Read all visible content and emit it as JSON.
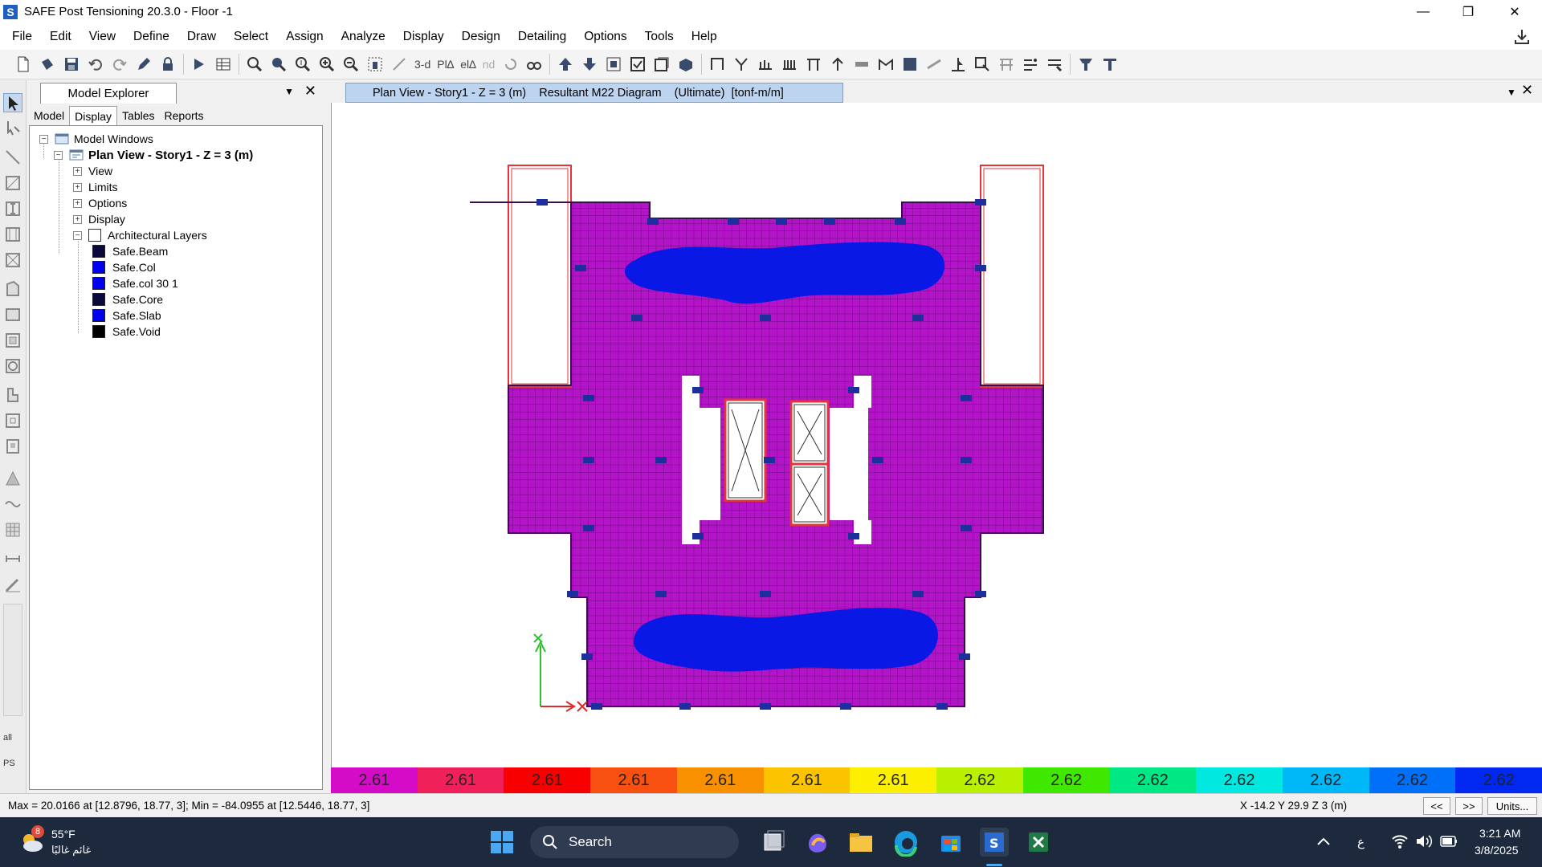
{
  "window": {
    "title": "SAFE Post Tensioning 20.3.0 - Floor -1",
    "app_icon_letter": "S",
    "minimize": "—",
    "maximize": "❐",
    "close": "✕"
  },
  "menu": [
    "File",
    "Edit",
    "View",
    "Define",
    "Draw",
    "Select",
    "Assign",
    "Analyze",
    "Display",
    "Design",
    "Detailing",
    "Options",
    "Tools",
    "Help"
  ],
  "toolbar": {
    "text_3d": "3-d",
    "text_pla": "Pl∆",
    "text_ela": "el∆",
    "text_nd": "nd"
  },
  "left_strip": {
    "all_label": "all",
    "ps_label": "PS"
  },
  "explorer": {
    "title": "Model Explorer",
    "pin": "▼",
    "close": "✕",
    "tabs": [
      "Model",
      "Display",
      "Tables",
      "Reports"
    ],
    "active_tab": "Display",
    "tree": {
      "root": "Model Windows",
      "plan": "Plan View - Story1 - Z = 3 (m)",
      "children": [
        "View",
        "Limits",
        "Options",
        "Display",
        "Architectural Layers"
      ],
      "layers": [
        {
          "name": "Safe.Beam",
          "color": "#0a0a3a"
        },
        {
          "name": "Safe.Col",
          "color": "#0000ee"
        },
        {
          "name": "Safe.col 30 1",
          "color": "#0000ee"
        },
        {
          "name": "Safe.Core",
          "color": "#0a0a3a"
        },
        {
          "name": "Safe.Slab",
          "color": "#0000ee"
        },
        {
          "name": "Safe.Void",
          "color": "#000000"
        }
      ]
    }
  },
  "document": {
    "tab_title": "Plan View - Story1 - Z = 3 (m)    Resultant M22 Diagram    (Ultimate)  [tonf-m/m]",
    "pin": "▼",
    "close": "✕",
    "colors": {
      "slab": "#b414c8",
      "grid": "#6a0c7e",
      "hot_zone": "#0a18e6",
      "outline": "#e5333a",
      "column": "#1c2f9c",
      "void": "#ffffff"
    }
  },
  "legend": {
    "values": [
      "2.61",
      "2.61",
      "2.61",
      "2.61",
      "2.61",
      "2.61",
      "2.61",
      "2.62",
      "2.62",
      "2.62",
      "2.62",
      "2.62",
      "2.62",
      "2.62"
    ],
    "colors": [
      "#d40cc8",
      "#f0205a",
      "#f80000",
      "#f85010",
      "#f89000",
      "#fcc400",
      "#fcf000",
      "#b8f000",
      "#40e800",
      "#00e884",
      "#00e8e0",
      "#00b8f8",
      "#0070f8",
      "#0028f0"
    ]
  },
  "status": {
    "minmax": "Max = 20.0166 at [12.8796, 18.77, 3];  Min = -84.0955 at [12.5446, 18.77, 3]",
    "coords": "X -14.2  Y 29.9  Z 3 (m)",
    "prev": "<<",
    "next": ">>",
    "units": "Units..."
  },
  "taskbar": {
    "weather_badge": "8",
    "temperature": "55°F",
    "weather_text": "غائم غالبًا",
    "search_label": "Search",
    "lang": "ع",
    "time": "3:21 AM",
    "date": "3/8/2025"
  }
}
